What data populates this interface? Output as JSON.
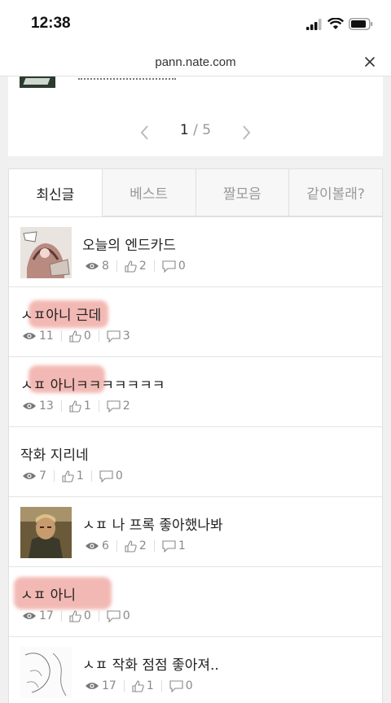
{
  "status": {
    "time": "12:38"
  },
  "browser": {
    "url": "pann.nate.com"
  },
  "pager": {
    "current": "1",
    "separator": "/",
    "total": "5"
  },
  "tabs": [
    {
      "label": "최신글",
      "active": true
    },
    {
      "label": "베스트"
    },
    {
      "label": "짤모음"
    },
    {
      "label": "같이볼래?"
    }
  ],
  "posts": [
    {
      "title": "오늘의 엔드카드",
      "views": "8",
      "likes": "2",
      "comments": "0"
    },
    {
      "title": "ㅅㅍ아니 근데",
      "views": "11",
      "likes": "0",
      "comments": "3"
    },
    {
      "title": "ㅅㅍ 아니ㅋㅋㅋㅋㅋㅋㅋ",
      "views": "13",
      "likes": "1",
      "comments": "2"
    },
    {
      "title": "작화 지리네",
      "views": "7",
      "likes": "1",
      "comments": "0"
    },
    {
      "title": "ㅅㅍ 나 프록 좋아했나봐",
      "views": "6",
      "likes": "2",
      "comments": "1"
    },
    {
      "title": "ㅅㅍ 아니",
      "views": "17",
      "likes": "0",
      "comments": "0"
    },
    {
      "title": "ㅅㅍ 작화 점점 좋아져..",
      "views": "17",
      "likes": "1",
      "comments": "0"
    }
  ]
}
